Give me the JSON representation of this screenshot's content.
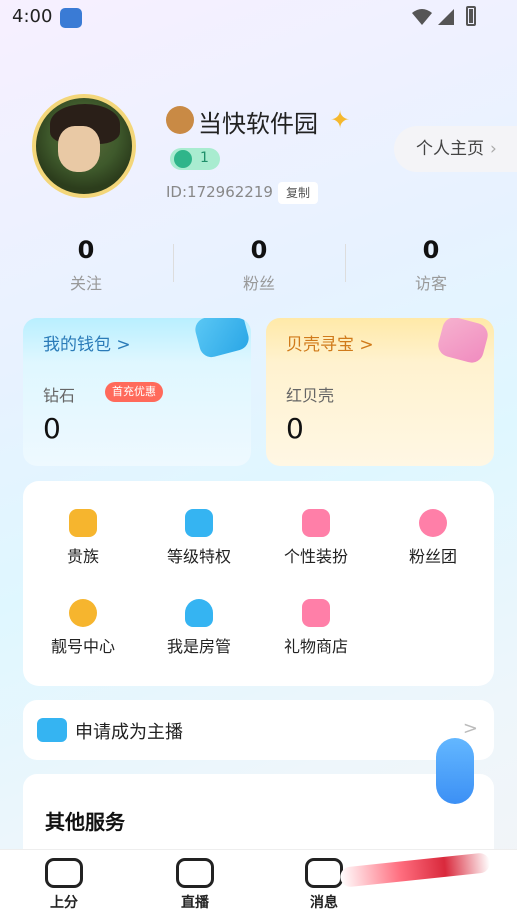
{
  "status_bar": {
    "time": "4:00",
    "icons": [
      "app-icon",
      "wifi-icon",
      "signal-icon",
      "battery-icon"
    ]
  },
  "profile": {
    "nickname": "当快软件园",
    "nickname_emoji": "monkey-icon",
    "nickname_decor": "sparkle-icon",
    "level": "1",
    "user_id": "ID:172962219",
    "copy_label": "复制",
    "profile_button": "个人主页",
    "avatar_icon": "avatar-image"
  },
  "stats": [
    {
      "value": "0",
      "label": "关注"
    },
    {
      "value": "0",
      "label": "粉丝"
    },
    {
      "value": "0",
      "label": "访客"
    }
  ],
  "wallet": {
    "title": "我的钱包",
    "item_label": "钻石",
    "promo": "首充优惠",
    "value": "0",
    "chev": ">"
  },
  "treasure": {
    "title": "贝壳寻宝",
    "item_label": "红贝壳",
    "value": "0",
    "chev": ">"
  },
  "menu": [
    {
      "label": "贵族",
      "icon": "crown-icon",
      "color": "#f6b52e"
    },
    {
      "label": "等级特权",
      "icon": "badge-icon",
      "color": "#35b4f2"
    },
    {
      "label": "个性装扮",
      "icon": "shirt-icon",
      "color": "#ff7fa8"
    },
    {
      "label": "粉丝团",
      "icon": "heart-icon",
      "color": "#ff7fa8"
    },
    {
      "label": "靓号中心",
      "icon": "pretty-number-icon",
      "color": "#f6b52e"
    },
    {
      "label": "我是房管",
      "icon": "admin-user-icon",
      "color": "#35b4f2"
    },
    {
      "label": "礼物商店",
      "icon": "gift-bag-icon",
      "color": "#ff7fa8"
    }
  ],
  "apply": {
    "label": "申请成为主播",
    "chev": ">"
  },
  "services": {
    "title": "其他服务"
  },
  "bottom_nav": [
    {
      "label": "上分",
      "icon": "gamepad-icon"
    },
    {
      "label": "直播",
      "icon": "video-camera-icon"
    },
    {
      "label": "消息",
      "icon": "message-icon"
    }
  ],
  "colors": {
    "accent_blue": "#35b4f2",
    "accent_orange": "#f6b52e",
    "promo_red": "#ff6a5b",
    "level_green": "#2fb58a"
  }
}
